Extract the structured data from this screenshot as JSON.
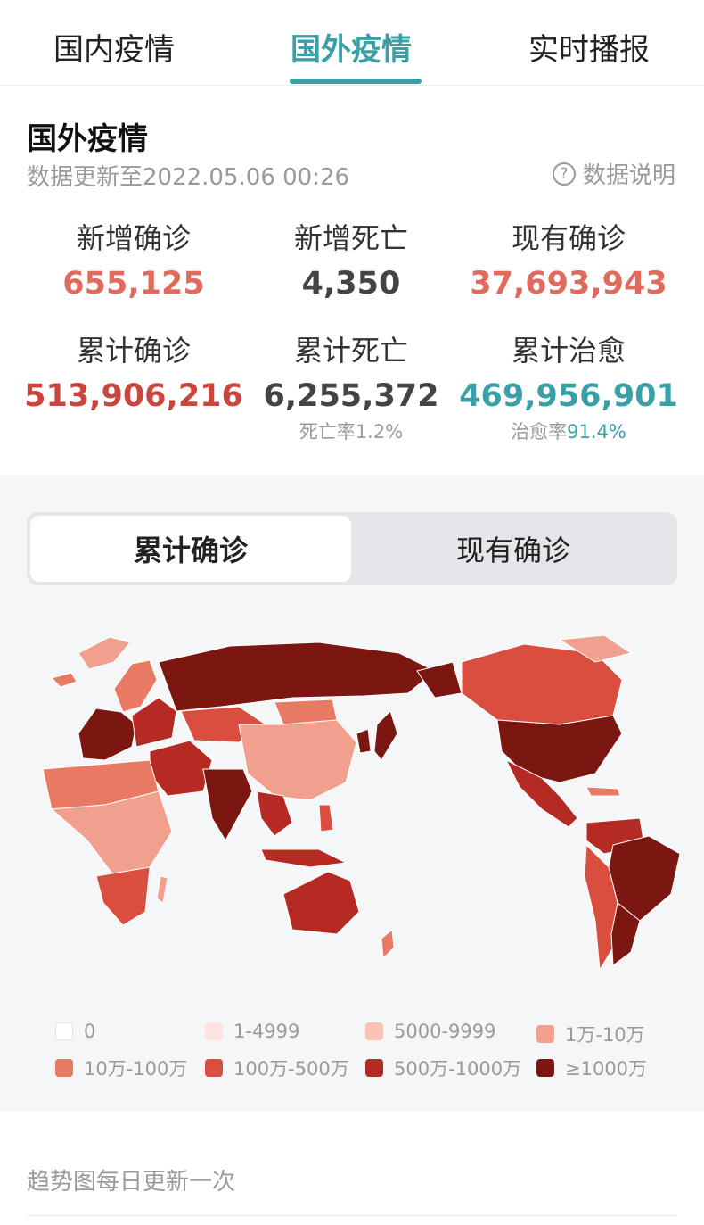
{
  "tabs": [
    {
      "label": "国内疫情",
      "active": false
    },
    {
      "label": "国外疫情",
      "active": true
    },
    {
      "label": "实时播报",
      "active": false
    }
  ],
  "section": {
    "title": "国外疫情",
    "update_time": "数据更新至2022.05.06 00:26",
    "explain_label": "数据说明"
  },
  "stats": {
    "new_confirmed": {
      "label": "新增确诊",
      "value": "655,125"
    },
    "new_deaths": {
      "label": "新增死亡",
      "value": "4,350"
    },
    "current_confirmed": {
      "label": "现有确诊",
      "value": "37,693,943"
    },
    "total_confirmed": {
      "label": "累计确诊",
      "value": "513,906,216"
    },
    "total_deaths": {
      "label": "累计死亡",
      "value": "6,255,372",
      "sub_label": "死亡率",
      "sub_value": "1.2%"
    },
    "total_recovered": {
      "label": "累计治愈",
      "value": "469,956,901",
      "sub_label": "治愈率",
      "sub_value": "91.4%"
    }
  },
  "map": {
    "toggle": {
      "active": "累计确诊",
      "inactive": "现有确诊"
    },
    "legend": [
      {
        "label": "0",
        "color": "#ffffff"
      },
      {
        "label": "1-4999",
        "color": "#fde4de"
      },
      {
        "label": "5000-9999",
        "color": "#f8c3b4"
      },
      {
        "label": "1万-10万",
        "color": "#f1a08e"
      },
      {
        "label": "10万-100万",
        "color": "#e87a64"
      },
      {
        "label": "100万-500万",
        "color": "#d94e3f"
      },
      {
        "label": "500万-1000万",
        "color": "#b52a22"
      },
      {
        "label": "≥1000万",
        "color": "#7c1610"
      }
    ]
  },
  "footer": {
    "trend_note": "趋势图每日更新一次"
  },
  "colors": {
    "accent": "#3aa0a8",
    "red_light": "#e06a5c",
    "red_dark": "#c9453e"
  }
}
